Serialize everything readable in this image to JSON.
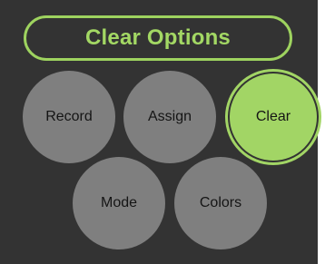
{
  "header": {
    "title": "Clear Options"
  },
  "buttons": {
    "record": "Record",
    "assign": "Assign",
    "clear": "Clear",
    "mode": "Mode",
    "colors": "Colors"
  },
  "state": {
    "selected": "Clear"
  },
  "colors": {
    "accent": "#a2d565",
    "background": "#333333",
    "button": "#7f7f7f"
  }
}
